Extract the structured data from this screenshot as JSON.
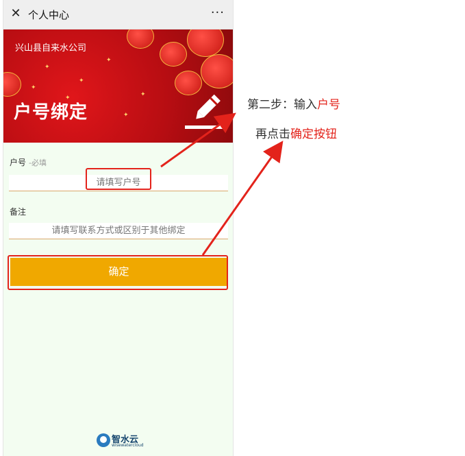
{
  "titlebar": {
    "close_icon": "close-icon",
    "title": "个人中心",
    "more_icon": "more-icon",
    "more_glyph": "···"
  },
  "banner": {
    "company": "兴山县自来水公司",
    "title": "户号绑定",
    "pen_icon": "pen-icon"
  },
  "form": {
    "account_label": "户号",
    "account_required": "-必填",
    "account_placeholder": "请填写户号",
    "note_label": "备注",
    "note_placeholder": "请填写联系方式或区别于其他绑定",
    "confirm_label": "确定"
  },
  "footer": {
    "logo_name": "智水云",
    "logo_sub": "wisewatercloud"
  },
  "annotations": {
    "step_prefix": "第二步：输入",
    "step_highlight": "户号",
    "then_prefix": "再点击",
    "then_highlight": "确定按钮"
  },
  "colors": {
    "banner_red": "#c5150f",
    "button_orange": "#f0a800",
    "highlight_red": "#e3231b",
    "page_bg": "#f3fdf1"
  }
}
